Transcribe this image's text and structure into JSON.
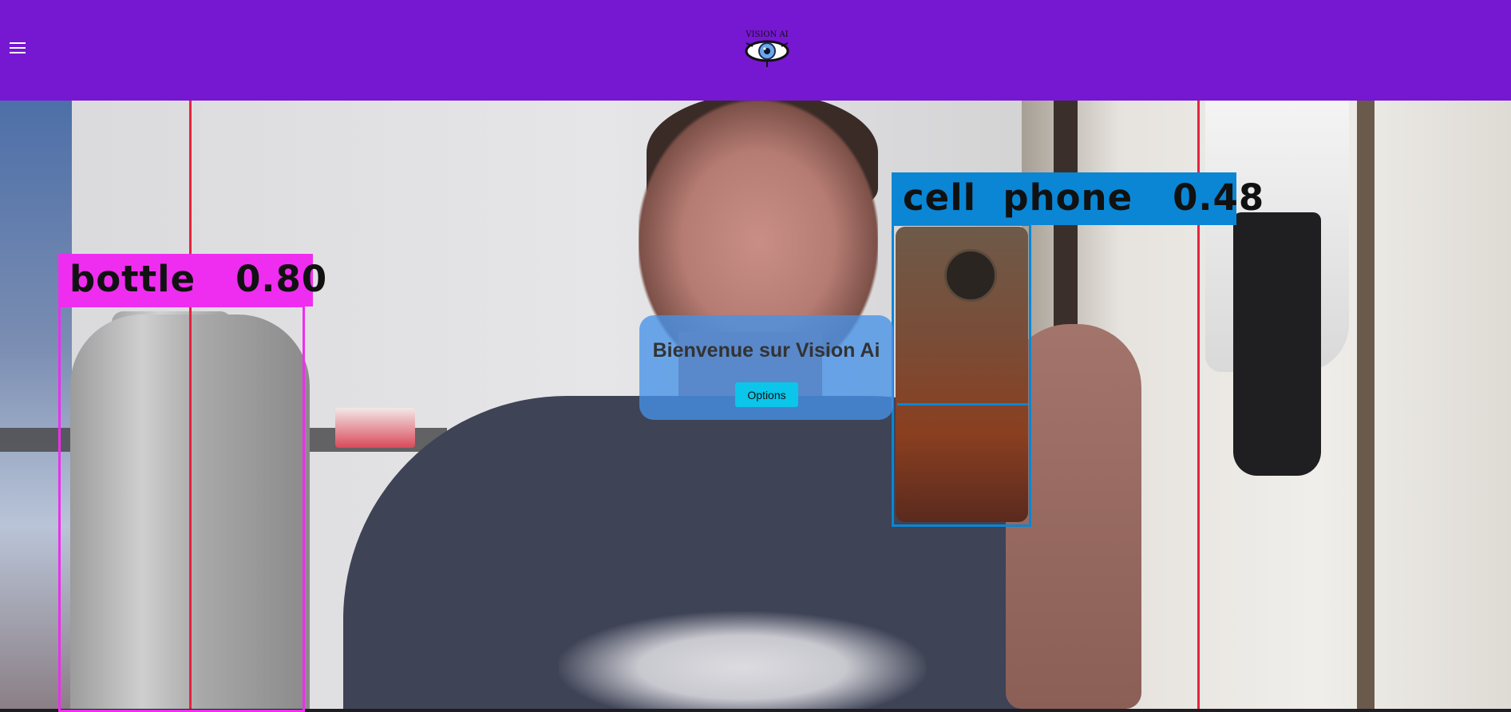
{
  "header": {
    "menu_icon": "hamburger-menu-icon",
    "logo_icon": "vision-ai-eye-logo",
    "logo_text": "VISION AI",
    "background_color": "#7617d2"
  },
  "detections": [
    {
      "label": "bottle",
      "score": "0.80",
      "color": "#ef2df0"
    },
    {
      "label": "cell  phone",
      "score": "0.48",
      "color": "#0a86d4"
    }
  ],
  "welcome": {
    "title": "Bienvenue sur Vision Ai",
    "options_label": "Options",
    "button_color": "#0bc5ea"
  },
  "colors": {
    "line_red": "#e5233e"
  }
}
